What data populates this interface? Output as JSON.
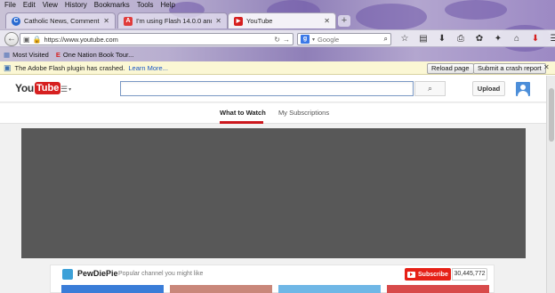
{
  "browser": {
    "menu": [
      "File",
      "Edit",
      "View",
      "History",
      "Bookmarks",
      "Tools",
      "Help"
    ],
    "tabs": [
      {
        "title": "Catholic News, Commenta...",
        "favicon": "C",
        "color": "#2a6bd1"
      },
      {
        "title": "I'm using Flash 14.0.0 and ...",
        "favicon": "A",
        "color": "#e03b3b"
      },
      {
        "title": "YouTube",
        "favicon": "▶",
        "color": "#d61f1f"
      }
    ],
    "url": "https://www.youtube.com",
    "search_placeholder": "Google",
    "bookmarks": [
      "Most Visited",
      "One Nation Book Tour..."
    ],
    "toolbar_icons": [
      "star-icon",
      "home-icon",
      "download-icon",
      "print-icon",
      "gear-icon",
      "addons-icon",
      "home2-icon",
      "menu-icon"
    ]
  },
  "notification": {
    "message": "The Adobe Flash plugin has crashed.",
    "learn_more": "Learn More...",
    "reload_button": "Reload page",
    "report_button": "Submit a crash report"
  },
  "youtube": {
    "logo_you": "You",
    "logo_tube": "Tube",
    "search_button": "🔍",
    "upload_button": "Upload",
    "nav_tabs": [
      "What to Watch",
      "My Subscriptions"
    ],
    "channel": {
      "name": "PewDiePie",
      "tagline": "Popular channel you might like",
      "subscribe_label": "Subscribe",
      "subscriber_count": "30,445,772"
    }
  }
}
